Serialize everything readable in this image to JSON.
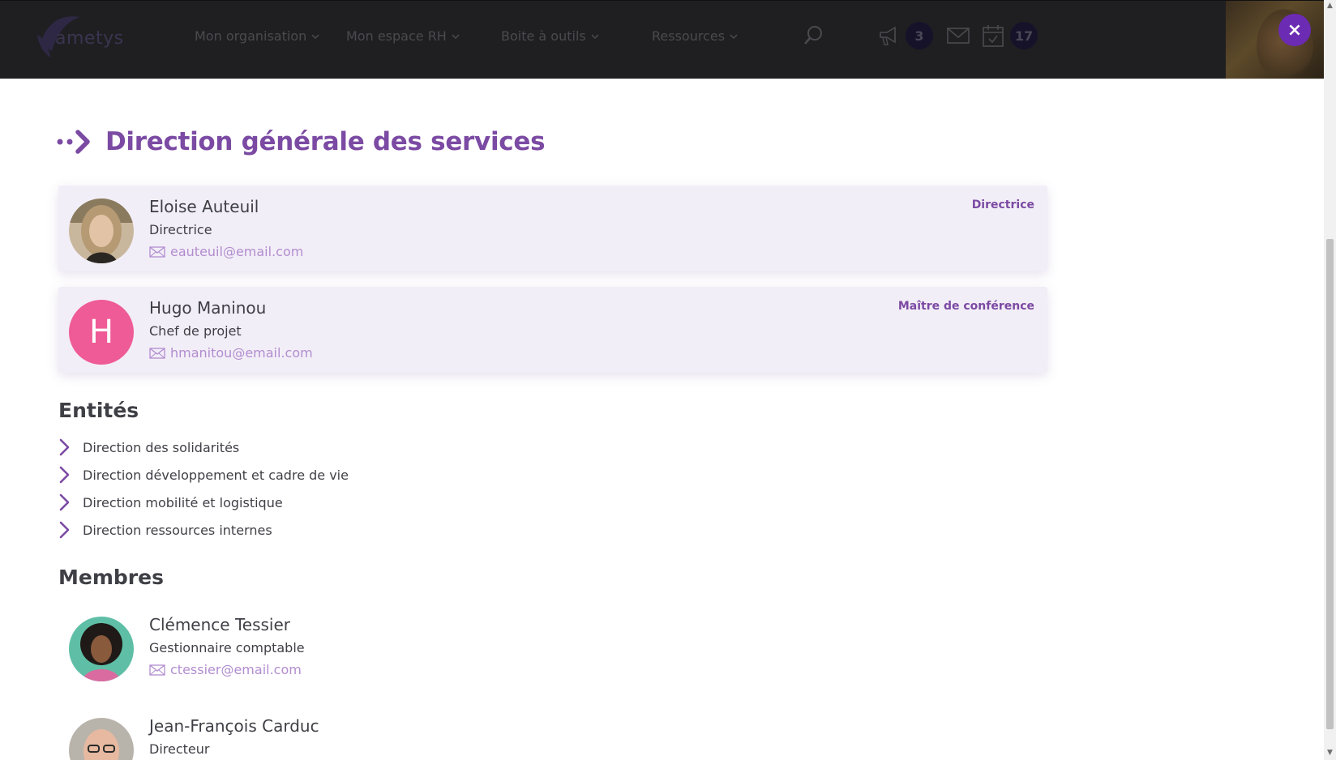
{
  "header": {
    "logo_text": "ametys",
    "nav": [
      {
        "label": "Mon organisation"
      },
      {
        "label": "Mon espace RH"
      },
      {
        "label": "Boite à outils"
      },
      {
        "label": "Ressources"
      }
    ],
    "badges": {
      "announcements": "3",
      "calendar": "17"
    },
    "close_label": "×"
  },
  "main": {
    "title": "Direction générale des services",
    "leaders": [
      {
        "name": "Eloise Auteuil",
        "role": "Directrice",
        "email": "eauteuil@email.com",
        "tag": "Directrice",
        "avatar": "photo"
      },
      {
        "name": "Hugo Maninou",
        "role": "Chef de projet",
        "email": "hmanitou@email.com",
        "tag": "Maître de conférence",
        "avatar_letter": "H"
      }
    ],
    "entities_title": "Entités",
    "entities": [
      {
        "label": "Direction des solidarités"
      },
      {
        "label": "Direction développement et cadre de vie"
      },
      {
        "label": "Direction mobilité et logistique"
      },
      {
        "label": "Direction ressources internes"
      }
    ],
    "members_title": "Membres",
    "members": [
      {
        "name": "Clémence Tessier",
        "role": "Gestionnaire comptable",
        "email": "ctessier@email.com"
      },
      {
        "name": "Jean-François Carduc",
        "role": "Directeur"
      }
    ]
  },
  "colors": {
    "accent": "#7b4aa3",
    "email": "#b28dd0",
    "card_bg": "#f2eef7",
    "avatar_pink": "#ef5b96",
    "close_button": "#6b2bb2"
  }
}
